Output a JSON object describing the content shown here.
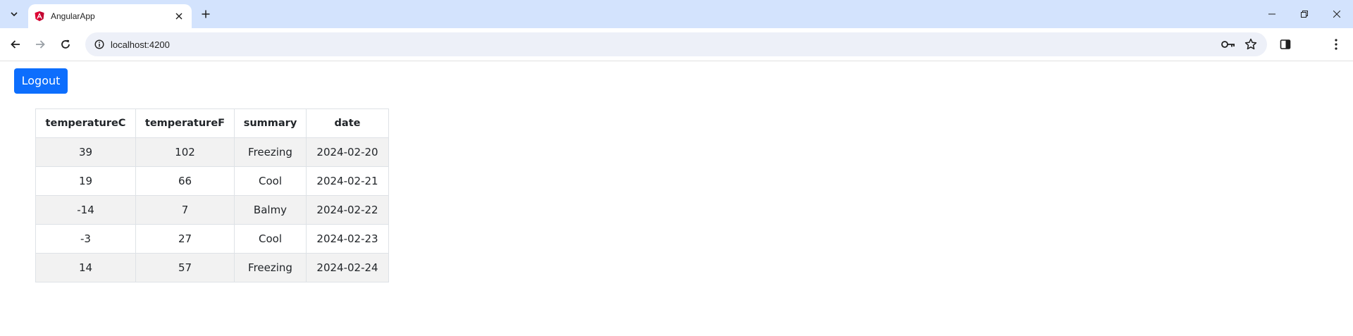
{
  "browser": {
    "tab": {
      "title": "AngularApp"
    },
    "omnibox": {
      "url": "localhost:4200"
    }
  },
  "page": {
    "logout_label": "Logout",
    "table": {
      "headers": [
        "temperatureC",
        "temperatureF",
        "summary",
        "date"
      ],
      "rows": [
        [
          "39",
          "102",
          "Freezing",
          "2024-02-20"
        ],
        [
          "19",
          "66",
          "Cool",
          "2024-02-21"
        ],
        [
          "-14",
          "7",
          "Balmy",
          "2024-02-22"
        ],
        [
          "-3",
          "27",
          "Cool",
          "2024-02-23"
        ],
        [
          "14",
          "57",
          "Freezing",
          "2024-02-24"
        ]
      ]
    }
  },
  "colors": {
    "tabstrip": "#d3e3fd",
    "omnibox": "#edf0f8",
    "primary_button": "#0d6efd",
    "striped_row": "#f2f2f2",
    "angular_brand": "#dd0031"
  },
  "icons": [
    "tab-search-icon",
    "angular-logo-icon",
    "close-icon",
    "plus-icon",
    "minimize-icon",
    "restore-icon",
    "window-close-icon",
    "back-arrow-icon",
    "forward-arrow-icon",
    "reload-icon",
    "site-info-icon",
    "key-icon",
    "star-icon",
    "side-panel-icon",
    "kebab-menu-icon"
  ]
}
